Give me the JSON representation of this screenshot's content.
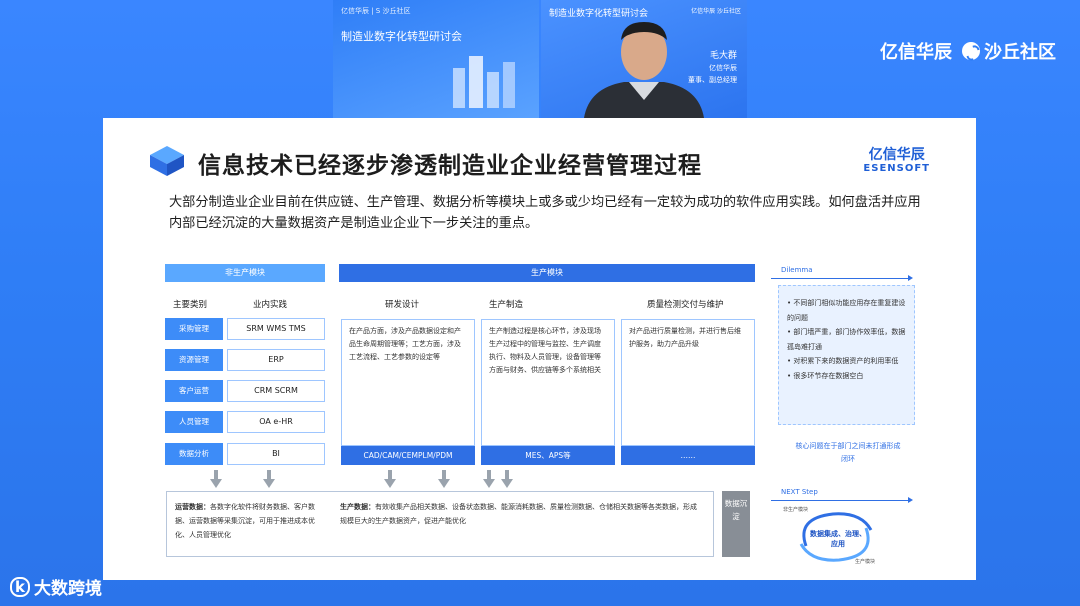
{
  "tile1": {
    "brand": "亿信华辰  |  S 沙丘社区",
    "title": "制造业数字化转型研讨会"
  },
  "tile2": {
    "title": "制造业数字化转型研讨会",
    "brand": "亿信华辰  沙丘社区",
    "speaker_name": "毛大群",
    "speaker_role_1": "亿信华辰",
    "speaker_role_2": "董事、副总经理"
  },
  "logos": {
    "left": "亿信华辰",
    "right": "沙丘社区"
  },
  "slide": {
    "title": "信息技术已经逐步渗透制造业企业经营管理过程",
    "brand_cn": "亿信华辰",
    "brand_en": "ESENSOFT",
    "intro": "大部分制造业企业目前在供应链、生产管理、数据分析等模块上或多或少均已经有一定较为成功的软件应用实践。如何盘活并应用内部已经沉淀的大量数据资产是制造业企业下一步关注的重点。",
    "non_prod": {
      "header": "非生产模块",
      "col1": "主要类别",
      "col2": "业内实践",
      "rows": [
        {
          "cat": "采购管理",
          "val": "SRM  WMS  TMS"
        },
        {
          "cat": "资源管理",
          "val": "ERP"
        },
        {
          "cat": "客户运营",
          "val": "CRM  SCRM"
        },
        {
          "cat": "人员管理",
          "val": "OA  e-HR"
        },
        {
          "cat": "数据分析",
          "val": "BI"
        }
      ]
    },
    "prod": {
      "header": "生产模块",
      "cols": [
        {
          "title": "研发设计",
          "body": "在产品方面，涉及产品数据设定和产品生命周期管理等；工艺方面，涉及工艺流程、工艺参数的设定等",
          "foot": "CAD/CAM/CEMPLM/PDM"
        },
        {
          "title": "生产制造",
          "body": "生产制造过程是核心环节，涉及现场生产过程中的管理与监控、生产调度执行、物料及人员管理，设备管理等方面与财务、供应链等多个系统相关",
          "foot": "MES、APS等"
        },
        {
          "title": "质量检测交付与维护",
          "body": "对产品进行质量检测，并进行售后维护服务，助力产品升级",
          "foot": "……"
        }
      ]
    },
    "bottom": {
      "ops_label": "运营数据：",
      "ops_text": "各数字化软件将财务数据、客户数据、运营数据等采集沉淀，可用于推进成本优化、人员管理优化",
      "prod_label": "生产数据：",
      "prod_text": "有效收集产品相关数据、设备状态数据、能源消耗数据、质量检测数据、仓储相关数据等各类数据，形成规模巨大的生产数据资产，促进产能优化",
      "accum": "数据沉淀"
    },
    "dilemma": {
      "label": "Dilemma",
      "items": [
        "不同部门相似功能应用存在重复建设的问题",
        "部门墙严重，部门协作效率低，数据孤岛难打通",
        "对积累下来的数据资产的利用率低",
        "很多环节存在数据空白"
      ],
      "note": "核心问题在于部门之间未打通形成闭环"
    },
    "next": {
      "label": "NEXT Step",
      "center": "数据集成、治理、应用",
      "left_caption": "非生产模块",
      "right_caption": "生产模块"
    }
  },
  "watermark": {
    "k": "k",
    "text": "大数跨境"
  }
}
